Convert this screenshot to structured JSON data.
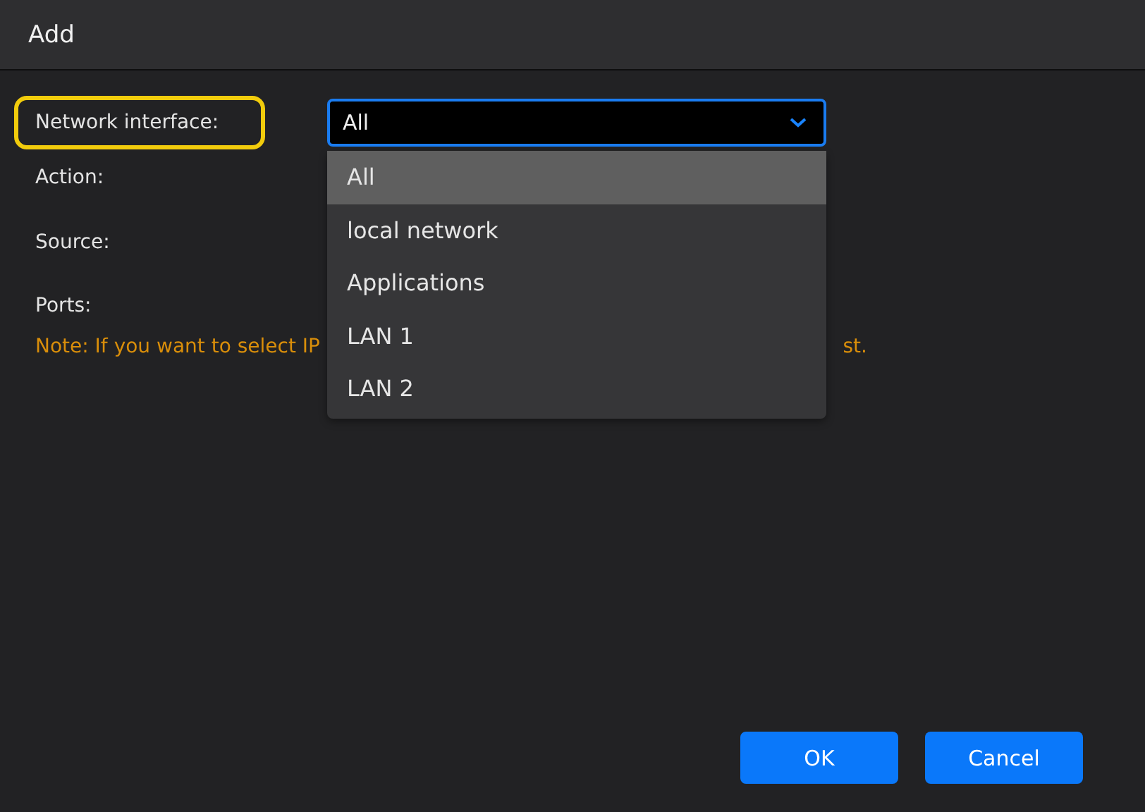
{
  "window": {
    "title": "Add"
  },
  "form": {
    "labels": [
      "Network interface:",
      "Action:",
      "Source:",
      "Ports:"
    ],
    "select": {
      "value": "All",
      "expanded": true
    },
    "options": [
      {
        "label": "All",
        "selected": true
      },
      {
        "label": "local network",
        "selected": false
      },
      {
        "label": "Applications",
        "selected": false
      },
      {
        "label": "LAN 1",
        "selected": false
      },
      {
        "label": "LAN 2",
        "selected": false
      }
    ],
    "note": [
      "Note: If you want to select IP",
      "st."
    ]
  },
  "buttons": [
    "OK",
    "Cancel"
  ]
}
